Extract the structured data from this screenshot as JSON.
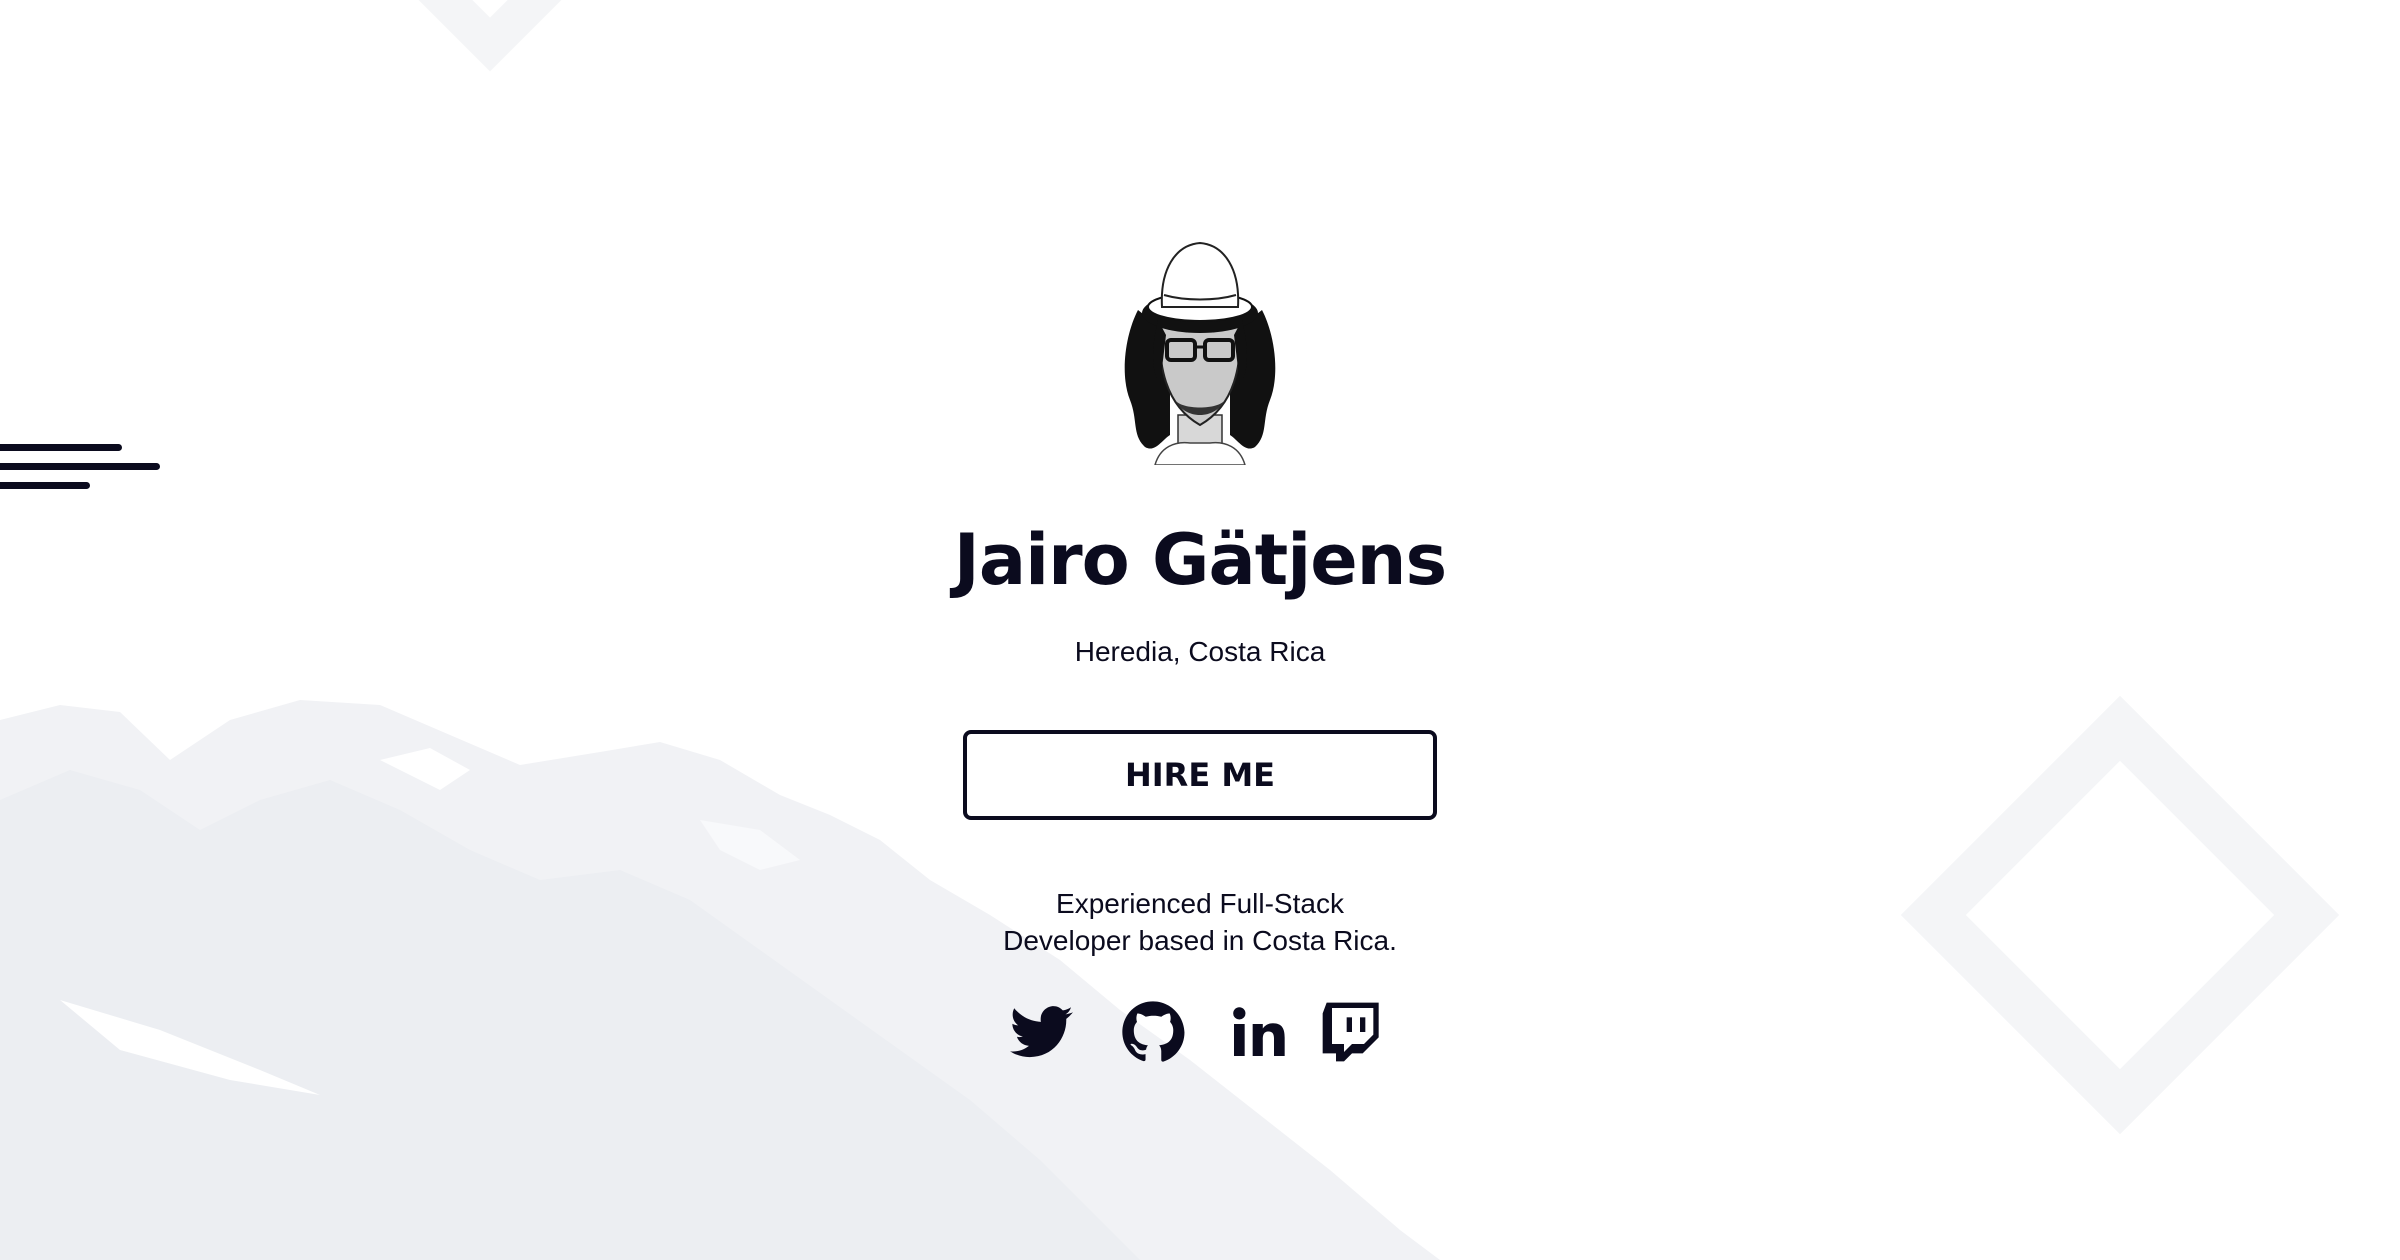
{
  "profile": {
    "name": "Jairo Gätjens",
    "location": "Heredia, Costa Rica",
    "hire_label": "HIRE ME",
    "bio_line1": "Experienced Full-Stack",
    "bio_line2": "Developer based in Costa Rica."
  },
  "socials": [
    {
      "icon": "twitter-icon"
    },
    {
      "icon": "github-icon"
    },
    {
      "icon": "linkedin-icon"
    },
    {
      "icon": "twitch-icon"
    }
  ],
  "colors": {
    "text": "#0b0b1e",
    "background": "#ffffff",
    "decoration": "#f4f5f7"
  }
}
